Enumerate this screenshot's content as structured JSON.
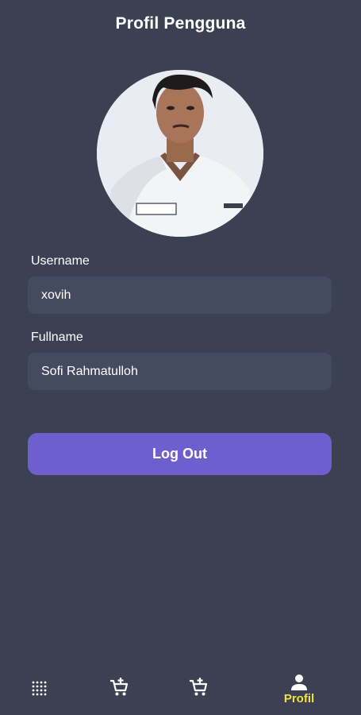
{
  "header": {
    "title": "Profil Pengguna"
  },
  "form": {
    "username_label": "Username",
    "username_value": "xovih",
    "fullname_label": "Fullname",
    "fullname_value": "Sofi Rahmatulloh"
  },
  "actions": {
    "logout_label": "Log Out"
  },
  "bottom_nav": {
    "items": [
      {
        "icon": "grid-dots-icon",
        "label": ""
      },
      {
        "icon": "cart-add-icon",
        "label": ""
      },
      {
        "icon": "cart-add-icon",
        "label": ""
      },
      {
        "icon": "person-icon",
        "label": "Profil",
        "active": true
      }
    ]
  },
  "colors": {
    "background": "#3b4153",
    "field": "#444b60",
    "button": "#6f5fce",
    "active_nav": "#f2e23b"
  }
}
